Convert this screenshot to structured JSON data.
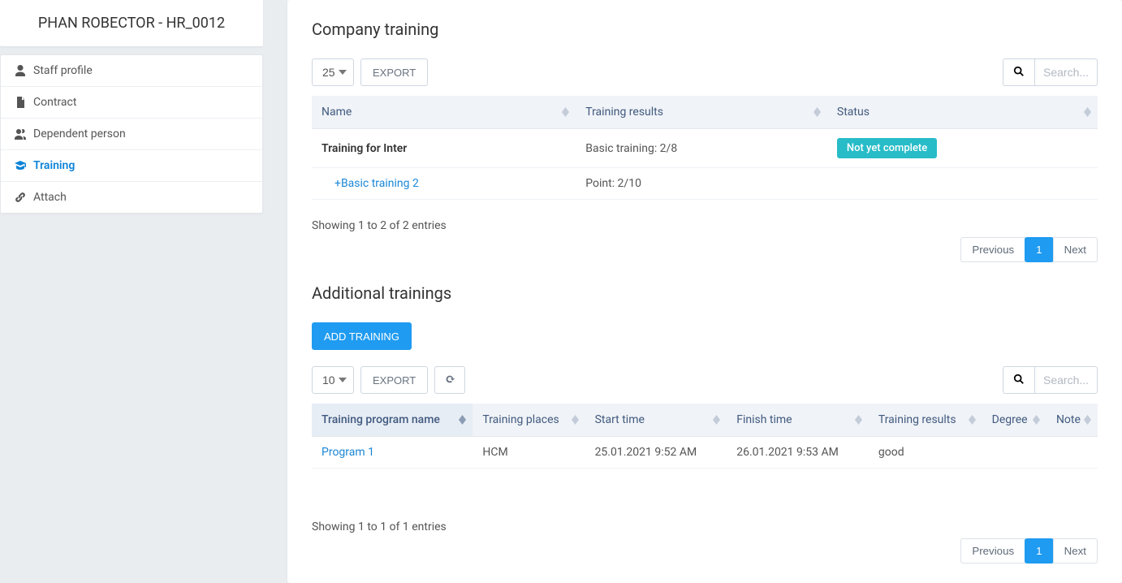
{
  "sidebar": {
    "title": "PHAN ROBECTOR - HR_0012",
    "items": [
      {
        "icon": "user",
        "label": "Staff profile",
        "active": false
      },
      {
        "icon": "file",
        "label": "Contract",
        "active": false
      },
      {
        "icon": "users",
        "label": "Dependent person",
        "active": false
      },
      {
        "icon": "grad",
        "label": "Training",
        "active": true
      },
      {
        "icon": "link",
        "label": "Attach",
        "active": false
      }
    ]
  },
  "company": {
    "title": "Company training",
    "page_size": "25",
    "export_label": "EXPORT",
    "search_placeholder": "Search...",
    "columns": [
      "Name",
      "Training results",
      "Status"
    ],
    "rows": [
      {
        "name": "Training for Inter",
        "results": "Basic training: 2/8",
        "status": "Not yet complete",
        "bold": true
      },
      {
        "name": "+Basic training 2",
        "results": "Point: 2/10",
        "status": "",
        "link": true,
        "indent": true
      }
    ],
    "entries_info": "Showing 1 to 2 of 2 entries",
    "pagination": {
      "prev": "Previous",
      "next": "Next",
      "current": "1"
    }
  },
  "additional": {
    "title": "Additional trainings",
    "add_label": "ADD TRAINING",
    "page_size": "10",
    "export_label": "EXPORT",
    "search_placeholder": "Search...",
    "columns": [
      "Training program name",
      "Training places",
      "Start time",
      "Finish time",
      "Training results",
      "Degree",
      "Note"
    ],
    "rows": [
      {
        "name": "Program 1",
        "places": "HCM",
        "start": "25.01.2021 9:52 AM",
        "finish": "26.01.2021 9:53 AM",
        "results": "good",
        "degree": "",
        "note": ""
      }
    ],
    "entries_info": "Showing 1 to 1 of 1 entries",
    "pagination": {
      "prev": "Previous",
      "next": "Next",
      "current": "1"
    }
  }
}
